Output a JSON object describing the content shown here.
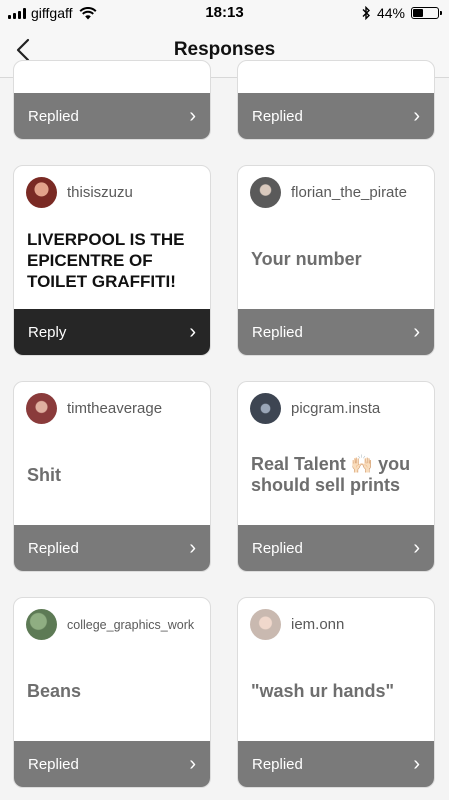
{
  "status_bar": {
    "carrier": "giffgaff",
    "time": "18:13",
    "battery": "44%",
    "battery_level": 0.44
  },
  "nav": {
    "title": "Responses",
    "back_icon": "chevron-left-icon"
  },
  "top_row": [
    {
      "status": "Replied"
    },
    {
      "status": "Replied"
    }
  ],
  "responses": [
    {
      "username": "thisiszuzu",
      "message": "LIVERPOOL IS THE EPICENTRE OF TOILET GRAFFITI!",
      "status": "Reply"
    },
    {
      "username": "florian_the_pirate",
      "message": "Your number",
      "status": "Replied"
    },
    {
      "username": "timtheaverage",
      "message": "Shit",
      "status": "Replied"
    },
    {
      "username": "picgram.insta",
      "message": "Real Talent 🙌🏻 you should sell prints",
      "status": "Replied"
    },
    {
      "username": "college_graphics_work",
      "message": "Beans",
      "status": "Replied"
    },
    {
      "username": "iem.onn",
      "message": "\"wash ur hands\"",
      "status": "Replied"
    }
  ],
  "avatar_colors": [
    "#7a2a24",
    "#5a5a5a",
    "#8a3b3b",
    "#3d4552",
    "#5d7a55",
    "#c9b9b0"
  ],
  "colors": {
    "replied_footer": "#7a7a7a",
    "reply_footer": "#262626"
  }
}
